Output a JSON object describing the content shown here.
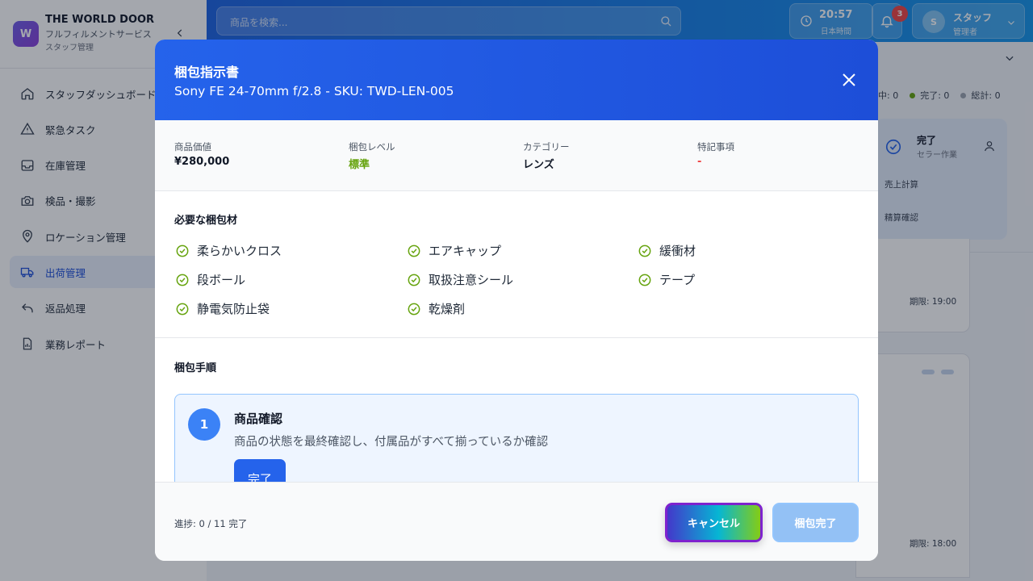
{
  "brand": {
    "logo_letter": "W",
    "name": "THE WORLD DOOR",
    "subtitle": "フルフィルメントサービス",
    "role": "スタッフ管理"
  },
  "sidebar": {
    "items": [
      {
        "label": "スタッフダッシュボード",
        "icon": "home-icon"
      },
      {
        "label": "緊急タスク",
        "icon": "warning-icon"
      },
      {
        "label": "在庫管理",
        "icon": "inbox-icon"
      },
      {
        "label": "検品・撮影",
        "icon": "camera-icon"
      },
      {
        "label": "ロケーション管理",
        "icon": "map-pin-icon"
      },
      {
        "label": "出荷管理",
        "icon": "truck-icon",
        "active": true
      },
      {
        "label": "返品処理",
        "icon": "return-arrow-icon"
      },
      {
        "label": "業務レポート",
        "icon": "report-icon"
      }
    ]
  },
  "header": {
    "search_placeholder": "商品を検索...",
    "clock_time": "20:57",
    "clock_label": "日本時間",
    "notification_count": "3",
    "user_initial": "S",
    "user_name": "スタッフ",
    "user_role": "管理者"
  },
  "background": {
    "stats": [
      "中: 0",
      "完了: 0",
      "総計: 0"
    ],
    "stat_colors": [
      "#9ca3af",
      "#65a30d",
      "#9ca3af"
    ],
    "card_title": "完了",
    "card_sub": "セラー作業",
    "card_line1": "売上計算",
    "card_line2": "精算確認",
    "due1": "期限: 19:00",
    "due2": "期限: 18:00"
  },
  "modal": {
    "title": "梱包指示書",
    "subtitle": "Sony FE 24-70mm f/2.8 - SKU: TWD-LEN-005",
    "info": [
      {
        "label": "商品価値",
        "value": "¥280,000",
        "tone": "normal"
      },
      {
        "label": "梱包レベル",
        "value": "標準",
        "tone": "green"
      },
      {
        "label": "カテゴリー",
        "value": "レンズ",
        "tone": "normal"
      },
      {
        "label": "特記事項",
        "value": "-",
        "tone": "red"
      }
    ],
    "materials_title": "必要な梱包材",
    "materials": [
      "柔らかいクロス",
      "エアキャップ",
      "緩衝材",
      "段ボール",
      "取扱注意シール",
      "テープ",
      "静電気防止袋",
      "乾燥剤"
    ],
    "steps_title": "梱包手順",
    "step": {
      "number": "1",
      "title": "商品確認",
      "description": "商品の状態を最終確認し、付属品がすべて揃っているか確認",
      "button": "完了"
    },
    "progress": "進捗: 0 / 11 完了",
    "cancel_button": "キャンセル",
    "complete_button": "梱包完了"
  }
}
